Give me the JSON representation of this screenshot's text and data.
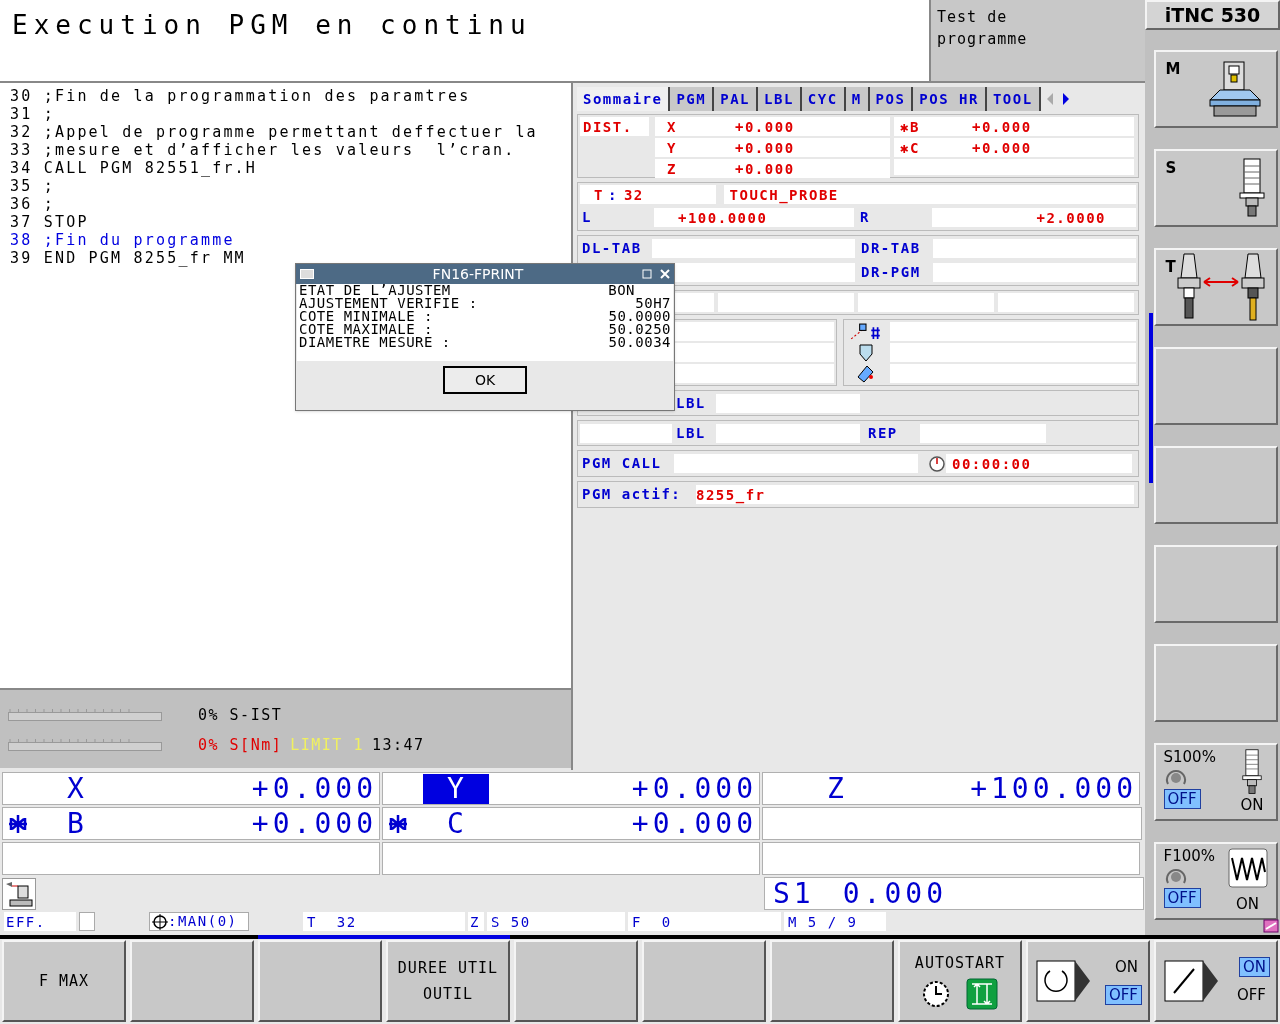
{
  "header": {
    "title": "Execution PGM en continu",
    "mode": [
      "Test de",
      "programme"
    ],
    "brand": "iTNC 530"
  },
  "program": [
    {
      "number": "30",
      "text": ";Fin de la programmation des paramtres",
      "current": false
    },
    {
      "number": "31",
      "text": ";",
      "current": false
    },
    {
      "number": "32",
      "text": ";Appel de programme permettant deffectuer la",
      "current": false
    },
    {
      "number": "33",
      "text": ";mesure et d’afficher les valeurs  l’cran.",
      "current": false
    },
    {
      "number": "34",
      "text": "CALL PGM 82551_fr.H",
      "current": false
    },
    {
      "number": "35",
      "text": ";",
      "current": false
    },
    {
      "number": "36",
      "text": ";",
      "current": false
    },
    {
      "number": "37",
      "text": "STOP",
      "current": false
    },
    {
      "number": "38",
      "text": ";Fin du programme",
      "current": true
    },
    {
      "number": "39",
      "text": "END PGM 8255_fr MM",
      "current": false
    }
  ],
  "gauges": [
    {
      "percent": "0%",
      "label": "S-IST",
      "alert": false
    },
    {
      "percent": "0%",
      "label": "S[Nm]",
      "alert": true
    }
  ],
  "gauge_extra": {
    "limit": "LIMIT 1",
    "time": "13:47"
  },
  "status_tabs": [
    {
      "label": "Sommaire",
      "selected": true
    },
    {
      "label": "PGM",
      "selected": false
    },
    {
      "label": "PAL",
      "selected": false
    },
    {
      "label": "LBL",
      "selected": false
    },
    {
      "label": "CYC",
      "selected": false
    },
    {
      "label": "M",
      "selected": false
    },
    {
      "label": "POS",
      "selected": false
    },
    {
      "label": "POS HR",
      "selected": false
    },
    {
      "label": "TOOL",
      "selected": false
    }
  ],
  "dist": {
    "label": "DIST.",
    "linear": [
      {
        "axis": "X",
        "value": "+0.000"
      },
      {
        "axis": "Y",
        "value": "+0.000"
      },
      {
        "axis": "Z",
        "value": "+0.000"
      }
    ],
    "rotary": [
      {
        "axis": "✱B",
        "value": "+0.000"
      },
      {
        "axis": "✱C",
        "value": "+0.000"
      }
    ]
  },
  "tool": {
    "t": "T",
    "sep": ":",
    "number": "32",
    "name": "TOUCH_PROBE",
    "l_label": "L",
    "l_value": "+100.0000",
    "r_label": "R",
    "r_value": "+2.0000"
  },
  "offsets": {
    "dl_tab": "DL-TAB",
    "dr_tab": "DR-TAB",
    "dr_pgm": "DR-PGM"
  },
  "labels": {
    "lbl1": "LBL",
    "lbl2": "LBL",
    "rep": "REP"
  },
  "pgm_call": {
    "label": "PGM CALL",
    "time": "00:00:00"
  },
  "pgm_active": {
    "label": "PGM actif:",
    "value": "8255_fr"
  },
  "dialog": {
    "title": "FN16-FPRINT",
    "lines": [
      {
        "label": "ETAT DE L’AJUSTEM",
        "value": "BON"
      },
      {
        "label": "AJUSTEMENT VERIFIE :",
        "value": "50H7"
      },
      {
        "label": "COTE MINIMALE :",
        "value": "50.0000"
      },
      {
        "label": "COTE MAXIMALE :",
        "value": "50.0250"
      },
      {
        "label": "DIAMETRE MESURE :",
        "value": "50.0034"
      }
    ],
    "button": "OK"
  },
  "axes": [
    {
      "axis": "X",
      "value": "+0.000",
      "selected": false,
      "clamped": false
    },
    {
      "axis": "Y",
      "value": "+0.000",
      "selected": true,
      "clamped": false
    },
    {
      "axis": "Z",
      "value": "+100.000",
      "selected": false,
      "clamped": false
    },
    {
      "axis": "B",
      "value": "+0.000",
      "selected": false,
      "clamped": true
    },
    {
      "axis": "C",
      "value": "+0.000",
      "selected": false,
      "clamped": true
    }
  ],
  "spindle_display": {
    "label": "S1",
    "value": "0.000"
  },
  "status_strip": {
    "eff": "EFF.",
    "datum": ":MAN(0)",
    "tool": "T  32",
    "axis": "Z",
    "spindle": "S 50",
    "feed": "F  0",
    "m": "M 5 / 9"
  },
  "side_keys": [
    {
      "kind": "icon",
      "letter": "M"
    },
    {
      "kind": "icon",
      "letter": "S"
    },
    {
      "kind": "icon",
      "letter": "T"
    },
    {
      "kind": "empty"
    },
    {
      "kind": "empty"
    },
    {
      "kind": "empty"
    },
    {
      "kind": "empty"
    },
    {
      "kind": "override",
      "label": "S100%",
      "options": [
        {
          "label": "OFF",
          "selected": true
        },
        {
          "label": "ON",
          "selected": false
        }
      ]
    },
    {
      "kind": "override",
      "label": "F100%",
      "options": [
        {
          "label": "OFF",
          "selected": true
        },
        {
          "label": "ON",
          "selected": false
        }
      ]
    }
  ],
  "soft_keys": [
    {
      "kind": "text",
      "lines": [
        "F MAX"
      ]
    },
    {
      "kind": "empty"
    },
    {
      "kind": "empty"
    },
    {
      "kind": "text",
      "lines": [
        "DUREE UTIL",
        "OUTIL"
      ]
    },
    {
      "kind": "empty"
    },
    {
      "kind": "empty"
    },
    {
      "kind": "empty"
    },
    {
      "kind": "autostart",
      "label": "AUTOSTART"
    },
    {
      "kind": "switch",
      "options": [
        {
          "label": "ON",
          "selected": false
        },
        {
          "label": "OFF",
          "selected": true
        }
      ]
    },
    {
      "kind": "switch",
      "options": [
        {
          "label": "ON",
          "selected": true
        },
        {
          "label": "OFF",
          "selected": false
        }
      ]
    }
  ]
}
